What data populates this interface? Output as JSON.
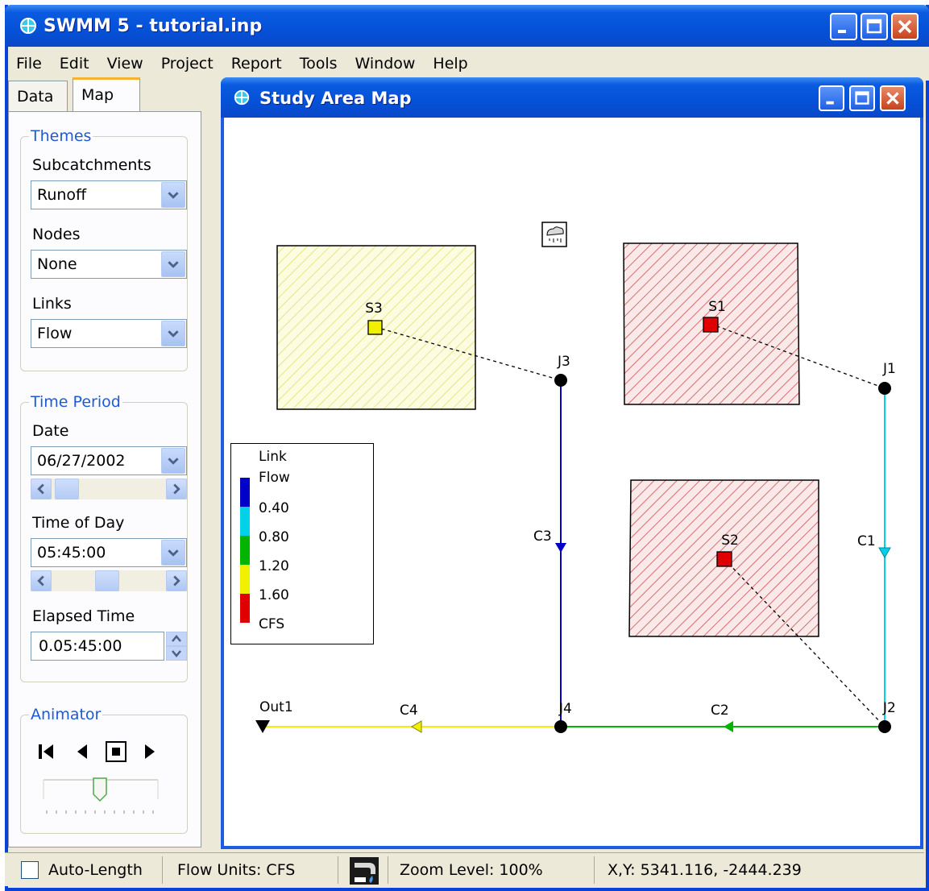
{
  "app": {
    "title": "SWMM 5 - tutorial.inp"
  },
  "menu": [
    "File",
    "Edit",
    "View",
    "Project",
    "Report",
    "Tools",
    "Window",
    "Help"
  ],
  "left_panel": {
    "tabs": [
      "Data",
      "Map"
    ],
    "active_tab": "Map",
    "themes": {
      "title": "Themes",
      "subcatchments_label": "Subcatchments",
      "subcatchments_value": "Runoff",
      "nodes_label": "Nodes",
      "nodes_value": "None",
      "links_label": "Links",
      "links_value": "Flow"
    },
    "time_period": {
      "title": "Time Period",
      "date_label": "Date",
      "date_value": "06/27/2002",
      "time_label": "Time of Day",
      "time_value": "05:45:00",
      "elapsed_label": "Elapsed Time",
      "elapsed_value": "0.05:45:00"
    },
    "animator": {
      "title": "Animator"
    }
  },
  "map_window": {
    "title": "Study Area Map",
    "legend": {
      "title1": "Link",
      "title2": "Flow",
      "values": [
        "0.40",
        "0.80",
        "1.20",
        "1.60"
      ],
      "units": "CFS",
      "colors": [
        "#0000c8",
        "#00d0e8",
        "#00b400",
        "#f0f000",
        "#e00000"
      ]
    },
    "subcatchments": [
      {
        "id": "S1",
        "color": "#c85050"
      },
      {
        "id": "S2",
        "color": "#c85050"
      },
      {
        "id": "S3",
        "color": "#e0e070"
      }
    ],
    "nodes": [
      "J1",
      "J2",
      "J3",
      "J4",
      "Out1"
    ],
    "links": [
      {
        "id": "C1",
        "color": "#00d0e8"
      },
      {
        "id": "C2",
        "color": "#00b400"
      },
      {
        "id": "C3",
        "color": "#0000c8"
      },
      {
        "id": "C4",
        "color": "#f0f000"
      }
    ]
  },
  "status": {
    "auto_length": "Auto-Length",
    "flow_units": "Flow Units: CFS",
    "zoom": "Zoom Level: 100%",
    "xy": "X,Y: 5341.116, -2444.239"
  }
}
